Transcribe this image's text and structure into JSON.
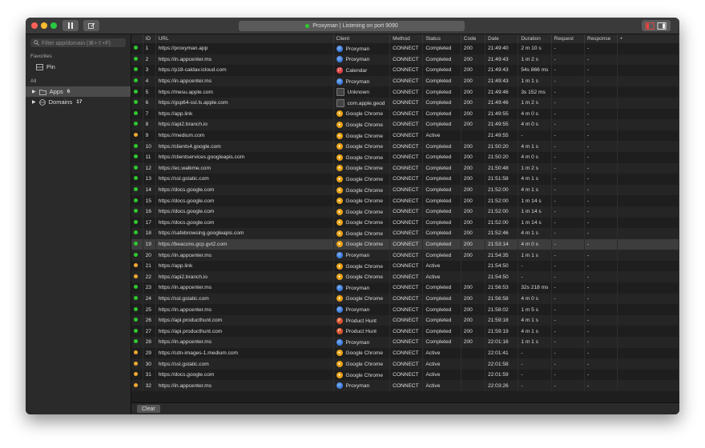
{
  "titlebar": {
    "status": "Proxyman | Listening on port 9090"
  },
  "sidebar": {
    "filter_placeholder": "Filter app/domain (⌘+⇧+F)",
    "favorites_label": "Favorites",
    "pin_label": "Pin",
    "all_label": "All",
    "apps_label": "Apps",
    "apps_count": "6",
    "domains_label": "Domains",
    "domains_count": "17"
  },
  "table": {
    "headers": [
      "",
      "ID",
      "URL",
      "Client",
      "Method",
      "Status",
      "Code",
      "Date",
      "Duration",
      "Request",
      "Response",
      "•"
    ],
    "rows": [
      {
        "dot": "green",
        "id": "1",
        "url": "https://proxyman.app",
        "client": "Proxyman",
        "method": "CONNECT",
        "status": "Completed",
        "code": "200",
        "date": "21:49:40",
        "duration": "2 m 10 s",
        "request": "-",
        "response": "-"
      },
      {
        "dot": "green",
        "id": "2",
        "url": "https://in.appcenter.ms",
        "client": "Proxyman",
        "method": "CONNECT",
        "status": "Completed",
        "code": "200",
        "date": "21:49:43",
        "duration": "1 m 2 s",
        "request": "-",
        "response": "-"
      },
      {
        "dot": "green",
        "id": "3",
        "url": "https://p18-caldav.icloud.com",
        "client": "Calendar",
        "method": "CONNECT",
        "status": "Completed",
        "code": "200",
        "date": "21:49:43",
        "duration": "54s 866 ms",
        "request": "-",
        "response": "-"
      },
      {
        "dot": "green",
        "id": "4",
        "url": "https://in.appcenter.ms",
        "client": "Proxyman",
        "method": "CONNECT",
        "status": "Completed",
        "code": "200",
        "date": "21:49:43",
        "duration": "1 m 1 s",
        "request": "-",
        "response": "-"
      },
      {
        "dot": "green",
        "id": "5",
        "url": "https://mesu.apple.com",
        "client": "Unknown",
        "method": "CONNECT",
        "status": "Completed",
        "code": "200",
        "date": "21:49:46",
        "duration": "3s 152 ms",
        "request": "-",
        "response": "-"
      },
      {
        "dot": "green",
        "id": "6",
        "url": "https://gsp64-ssl.ls.apple.com",
        "client": "com.apple.geod",
        "method": "CONNECT",
        "status": "Completed",
        "code": "200",
        "date": "21:49:46",
        "duration": "1 m 2 s",
        "request": "-",
        "response": "-"
      },
      {
        "dot": "green",
        "id": "7",
        "url": "https://app.link",
        "client": "Google Chrome",
        "method": "CONNECT",
        "status": "Completed",
        "code": "200",
        "date": "21:49:55",
        "duration": "4 m 0 s",
        "request": "-",
        "response": "-"
      },
      {
        "dot": "green",
        "id": "8",
        "url": "https://api2.branch.io",
        "client": "Google Chrome",
        "method": "CONNECT",
        "status": "Completed",
        "code": "200",
        "date": "21:49:55",
        "duration": "4 m 0 s",
        "request": "-",
        "response": "-"
      },
      {
        "dot": "orange",
        "id": "9",
        "url": "https://medium.com",
        "client": "Google Chrome",
        "method": "CONNECT",
        "status": "Active",
        "code": "",
        "date": "21:49:55",
        "duration": "-",
        "request": "-",
        "response": "-"
      },
      {
        "dot": "green",
        "id": "10",
        "url": "https://clients4.google.com",
        "client": "Google Chrome",
        "method": "CONNECT",
        "status": "Completed",
        "code": "200",
        "date": "21:50:20",
        "duration": "4 m 1 s",
        "request": "-",
        "response": "-"
      },
      {
        "dot": "green",
        "id": "11",
        "url": "https://clientservices.googleapis.com",
        "client": "Google Chrome",
        "method": "CONNECT",
        "status": "Completed",
        "code": "200",
        "date": "21:50:20",
        "duration": "4 m 0 s",
        "request": "-",
        "response": "-"
      },
      {
        "dot": "green",
        "id": "12",
        "url": "https://ec.walkme.com",
        "client": "Google Chrome",
        "method": "CONNECT",
        "status": "Completed",
        "code": "200",
        "date": "21:50:48",
        "duration": "1 m 2 s",
        "request": "-",
        "response": "-"
      },
      {
        "dot": "green",
        "id": "13",
        "url": "https://ssl.gstatic.com",
        "client": "Google Chrome",
        "method": "CONNECT",
        "status": "Completed",
        "code": "200",
        "date": "21:51:58",
        "duration": "4 m 1 s",
        "request": "-",
        "response": "-"
      },
      {
        "dot": "green",
        "id": "14",
        "url": "https://docs.google.com",
        "client": "Google Chrome",
        "method": "CONNECT",
        "status": "Completed",
        "code": "200",
        "date": "21:52:00",
        "duration": "4 m 1 s",
        "request": "-",
        "response": "-"
      },
      {
        "dot": "green",
        "id": "15",
        "url": "https://docs.google.com",
        "client": "Google Chrome",
        "method": "CONNECT",
        "status": "Completed",
        "code": "200",
        "date": "21:52:00",
        "duration": "1 m 14 s",
        "request": "-",
        "response": "-"
      },
      {
        "dot": "green",
        "id": "16",
        "url": "https://docs.google.com",
        "client": "Google Chrome",
        "method": "CONNECT",
        "status": "Completed",
        "code": "200",
        "date": "21:52:00",
        "duration": "1 m 14 s",
        "request": "-",
        "response": "-"
      },
      {
        "dot": "green",
        "id": "17",
        "url": "https://docs.google.com",
        "client": "Google Chrome",
        "method": "CONNECT",
        "status": "Completed",
        "code": "200",
        "date": "21:52:00",
        "duration": "1 m 14 s",
        "request": "-",
        "response": "-"
      },
      {
        "dot": "green",
        "id": "18",
        "url": "https://safebrowsing.googleapis.com",
        "client": "Google Chrome",
        "method": "CONNECT",
        "status": "Completed",
        "code": "200",
        "date": "21:52:46",
        "duration": "4 m 1 s",
        "request": "-",
        "response": "-"
      },
      {
        "dot": "green",
        "id": "19",
        "url": "https://beacons.gcp.gvt2.com",
        "client": "Google Chrome",
        "method": "CONNECT",
        "status": "Completed",
        "code": "200",
        "date": "21:53:14",
        "duration": "4 m 0 s",
        "request": "-",
        "response": "-",
        "selected": true
      },
      {
        "dot": "green",
        "id": "20",
        "url": "https://in.appcenter.ms",
        "client": "Proxyman",
        "method": "CONNECT",
        "status": "Completed",
        "code": "200",
        "date": "21:54:35",
        "duration": "1 m 1 s",
        "request": "-",
        "response": "-"
      },
      {
        "dot": "orange",
        "id": "21",
        "url": "https://app.link",
        "client": "Google Chrome",
        "method": "CONNECT",
        "status": "Active",
        "code": "",
        "date": "21:54:50",
        "duration": "-",
        "request": "-",
        "response": "-"
      },
      {
        "dot": "orange",
        "id": "22",
        "url": "https://api2.branch.io",
        "client": "Google Chrome",
        "method": "CONNECT",
        "status": "Active",
        "code": "",
        "date": "21:54:50",
        "duration": "-",
        "request": "-",
        "response": "-"
      },
      {
        "dot": "green",
        "id": "23",
        "url": "https://in.appcenter.ms",
        "client": "Proxyman",
        "method": "CONNECT",
        "status": "Completed",
        "code": "200",
        "date": "21:56:53",
        "duration": "32s 218 ms",
        "request": "-",
        "response": "-"
      },
      {
        "dot": "green",
        "id": "24",
        "url": "https://ssl.gstatic.com",
        "client": "Google Chrome",
        "method": "CONNECT",
        "status": "Completed",
        "code": "200",
        "date": "21:56:58",
        "duration": "4 m 0 s",
        "request": "-",
        "response": "-"
      },
      {
        "dot": "green",
        "id": "25",
        "url": "https://in.appcenter.ms",
        "client": "Proxyman",
        "method": "CONNECT",
        "status": "Completed",
        "code": "200",
        "date": "21:58:02",
        "duration": "1 m 5 s",
        "request": "-",
        "response": "-"
      },
      {
        "dot": "green",
        "id": "26",
        "url": "https://api.producthunt.com",
        "client": "Product Hunt",
        "method": "CONNECT",
        "status": "Completed",
        "code": "200",
        "date": "21:59:18",
        "duration": "4 m 1 s",
        "request": "-",
        "response": "-"
      },
      {
        "dot": "green",
        "id": "27",
        "url": "https://api.producthunt.com",
        "client": "Product Hunt",
        "method": "CONNECT",
        "status": "Completed",
        "code": "200",
        "date": "21:59:19",
        "duration": "4 m 1 s",
        "request": "-",
        "response": "-"
      },
      {
        "dot": "green",
        "id": "28",
        "url": "https://in.appcenter.ms",
        "client": "Proxyman",
        "method": "CONNECT",
        "status": "Completed",
        "code": "200",
        "date": "22:01:16",
        "duration": "1 m 1 s",
        "request": "-",
        "response": "-"
      },
      {
        "dot": "orange",
        "id": "29",
        "url": "https://cdn-images-1.medium.com",
        "client": "Google Chrome",
        "method": "CONNECT",
        "status": "Active",
        "code": "",
        "date": "22:01:41",
        "duration": "-",
        "request": "-",
        "response": "-"
      },
      {
        "dot": "orange",
        "id": "30",
        "url": "https://ssl.gstatic.com",
        "client": "Google Chrome",
        "method": "CONNECT",
        "status": "Active",
        "code": "",
        "date": "22:01:58",
        "duration": "-",
        "request": "-",
        "response": "-"
      },
      {
        "dot": "orange",
        "id": "31",
        "url": "https://docs.google.com",
        "client": "Google Chrome",
        "method": "CONNECT",
        "status": "Active",
        "code": "",
        "date": "22:01:59",
        "duration": "-",
        "request": "-",
        "response": "-"
      },
      {
        "dot": "orange",
        "id": "32",
        "url": "https://in.appcenter.ms",
        "client": "Proxyman",
        "method": "CONNECT",
        "status": "Active",
        "code": "",
        "date": "22:03:26",
        "duration": "-",
        "request": "-",
        "response": "-"
      }
    ]
  },
  "footer": {
    "clear_label": "Clear"
  },
  "colors": {
    "green": "#2dc92d",
    "orange": "#f0a832",
    "proxyman": "#3d7fe0",
    "chrome": "#e8a317",
    "calendar": "#e04040",
    "producthunt": "#da552f",
    "unknown": "#444444"
  }
}
